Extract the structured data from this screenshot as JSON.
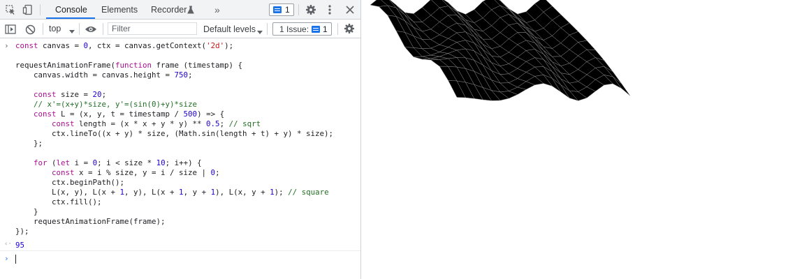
{
  "devtools": {
    "tabs": {
      "console": "Console",
      "elements": "Elements",
      "recorder": "Recorder",
      "more": "»"
    },
    "issues_badge_count": "1",
    "toolbar": {
      "context": "top",
      "filter_placeholder": "Filter",
      "levels": "Default levels",
      "issues_label": "1 Issue:",
      "issues_count": "1"
    },
    "console": {
      "input_line": "const canvas = $0, ctx = canvas.getContext('2d');",
      "code": [
        "requestAnimationFrame(function frame (timestamp) {",
        "    canvas.width = canvas.height = 750;",
        "",
        "    const size = 20;",
        "    // x'=(x+y)*size, y'=(sin(0)+y)*size",
        "    const L = (x, y, t = timestamp / 500) => {",
        "        const length = (x * x + y * y) ** 0.5; // sqrt",
        "        ctx.lineTo((x + y) * size, (Math.sin(length + t) + y) * size);",
        "    };",
        "",
        "    for (let i = 0; i < size * 10; i++) {",
        "        const x = i % size, y = i / size | 0;",
        "        ctx.beginPath();",
        "        L(x, y), L(x + 1, y), L(x + 1, y + 1), L(x, y + 1); // square",
        "        ctx.fill();",
        "    }",
        "    requestAnimationFrame(frame);",
        "});"
      ],
      "result": "95"
    }
  },
  "colors": {
    "accent": "#1a73e8",
    "surface_fill": "#000000",
    "surface_grid": "#8a8a8a"
  }
}
